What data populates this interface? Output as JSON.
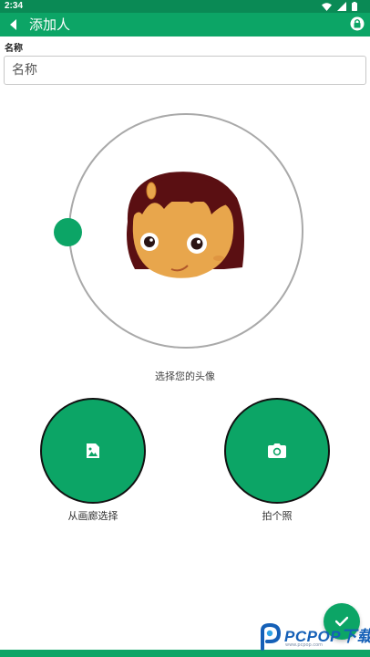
{
  "status_bar": {
    "time": "2:34"
  },
  "app_bar": {
    "title": "添加人"
  },
  "form": {
    "name_label": "名称",
    "name_placeholder": "名称",
    "name_value": ""
  },
  "avatar": {
    "caption": "选择您的头像"
  },
  "actions": {
    "gallery_label": "从画廊选择",
    "camera_label": "拍个照"
  },
  "watermark": {
    "text": "PCPOP下载",
    "subtext": "www.pcpop.com"
  },
  "colors": {
    "primary": "#0ca566",
    "status_bar": "#0a8a55",
    "ring": "#a9a9a9"
  },
  "icons": {
    "back": "chevron-left-icon",
    "lock": "lock-icon",
    "gallery": "image-icon",
    "camera": "camera-icon",
    "confirm": "check-icon"
  }
}
